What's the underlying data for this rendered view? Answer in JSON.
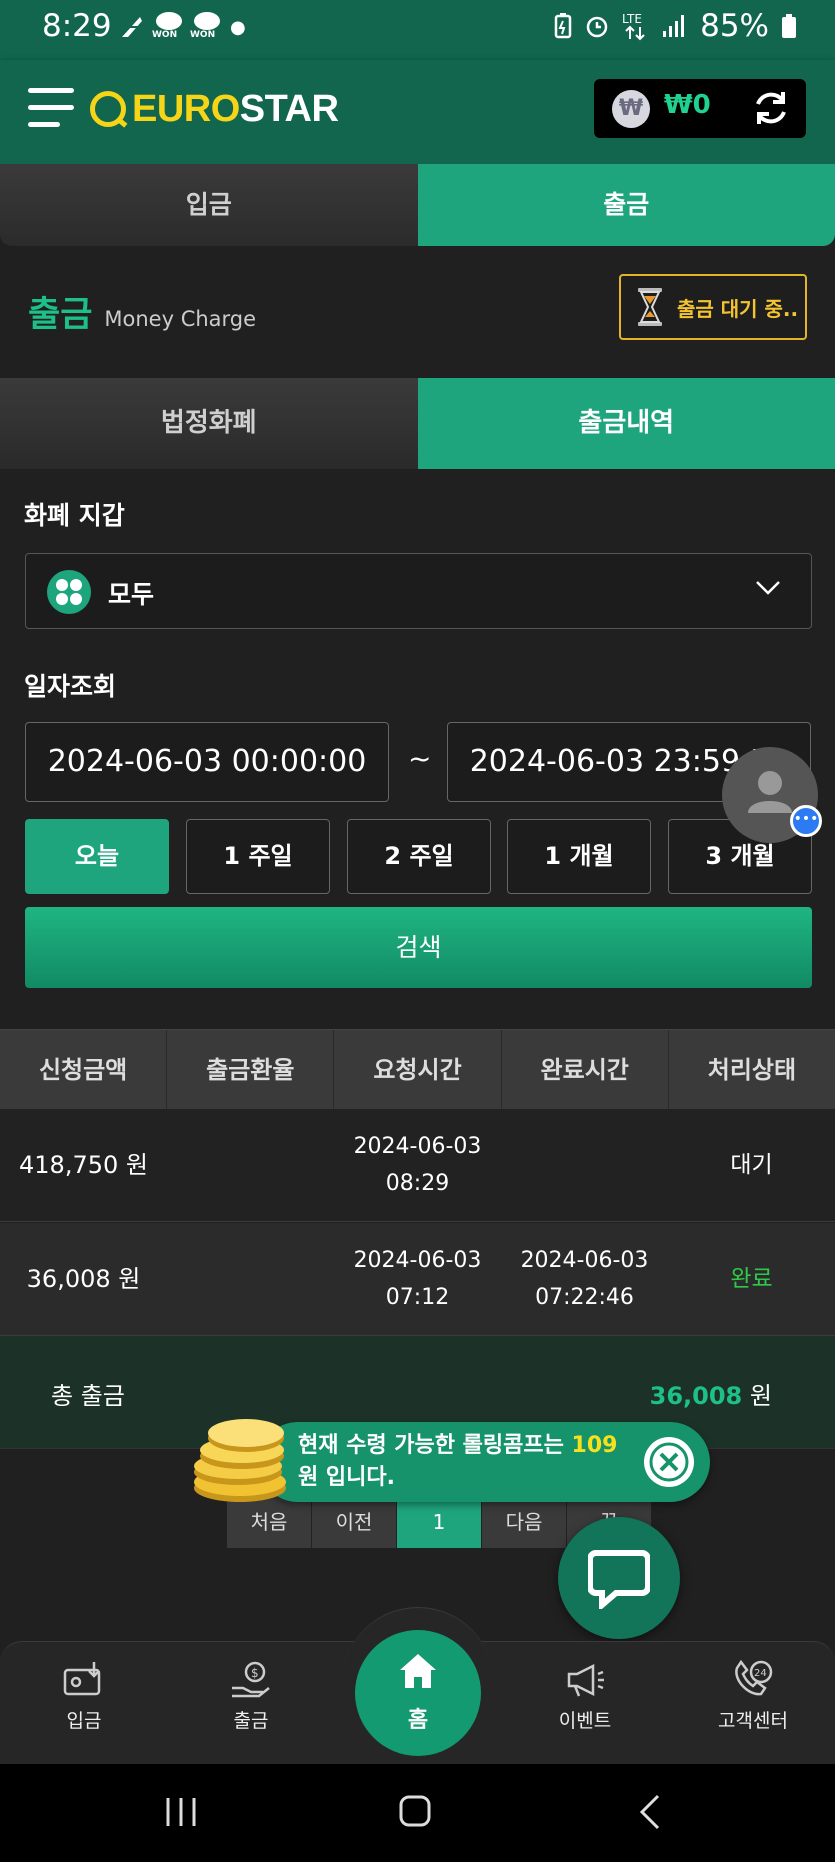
{
  "status_bar": {
    "time": "8:29",
    "won_label": "WON",
    "battery": "85%"
  },
  "header": {
    "logo_euro": "EURO",
    "logo_star": "STAR",
    "wallet_symbol": "₩",
    "wallet_amount": "₩0"
  },
  "top_tabs": [
    {
      "label": "입금",
      "active": false
    },
    {
      "label": "출금",
      "active": true
    }
  ],
  "section": {
    "title_ko": "출금",
    "title_en": "Money Charge",
    "pending_label": "출금 대기 중.."
  },
  "sub_tabs": [
    {
      "label": "법정화폐",
      "active": false
    },
    {
      "label": "출금내역",
      "active": true
    }
  ],
  "wallet_filter": {
    "label": "화폐 지갑",
    "selected": "모두"
  },
  "date_filter": {
    "label": "일자조회",
    "from": "2024-06-03 00:00:00",
    "separator": "~",
    "to": "2024-06-03 23:59:59"
  },
  "periods": [
    {
      "label": "오늘",
      "active": true
    },
    {
      "label": "1 주일",
      "active": false
    },
    {
      "label": "2 주일",
      "active": false
    },
    {
      "label": "1 개월",
      "active": false
    },
    {
      "label": "3 개월",
      "active": false
    }
  ],
  "search_label": "검색",
  "table": {
    "headers": [
      "신청금액",
      "출금환율",
      "요청시간",
      "완료시간",
      "처리상태"
    ],
    "rows": [
      {
        "amount": "418,750 원",
        "rate": "",
        "requested_date": "2024-06-03",
        "requested_time": "08:29",
        "completed_date": "",
        "completed_time": "",
        "status": "대기"
      },
      {
        "amount": "36,008 원",
        "rate": "",
        "requested_date": "2024-06-03",
        "requested_time": "07:12",
        "completed_date": "2024-06-03",
        "completed_time": "07:22:46",
        "status": "완료"
      }
    ]
  },
  "total": {
    "label": "총 출금",
    "amount": "36,008",
    "unit": "원"
  },
  "pagination": [
    "처음",
    "이전",
    "1",
    "다음",
    "끝"
  ],
  "banner": {
    "text_pre": "현재 수령 가능한 롤링콤프는 ",
    "amount": "109",
    "text_post": " 원 입니다."
  },
  "bottom_nav": [
    {
      "label": "입금",
      "icon": "deposit-icon"
    },
    {
      "label": "출금",
      "icon": "withdraw-icon"
    },
    {
      "label": "홈",
      "icon": "home-icon"
    },
    {
      "label": "이벤트",
      "icon": "megaphone-icon"
    },
    {
      "label": "고객센터",
      "icon": "support-24-icon"
    }
  ],
  "colors": {
    "brand": "#12664d",
    "accent": "#1ea57e",
    "logo_yellow": "#f6d418",
    "pending_yellow": "#f4c430",
    "done_green": "#2ec84a"
  }
}
